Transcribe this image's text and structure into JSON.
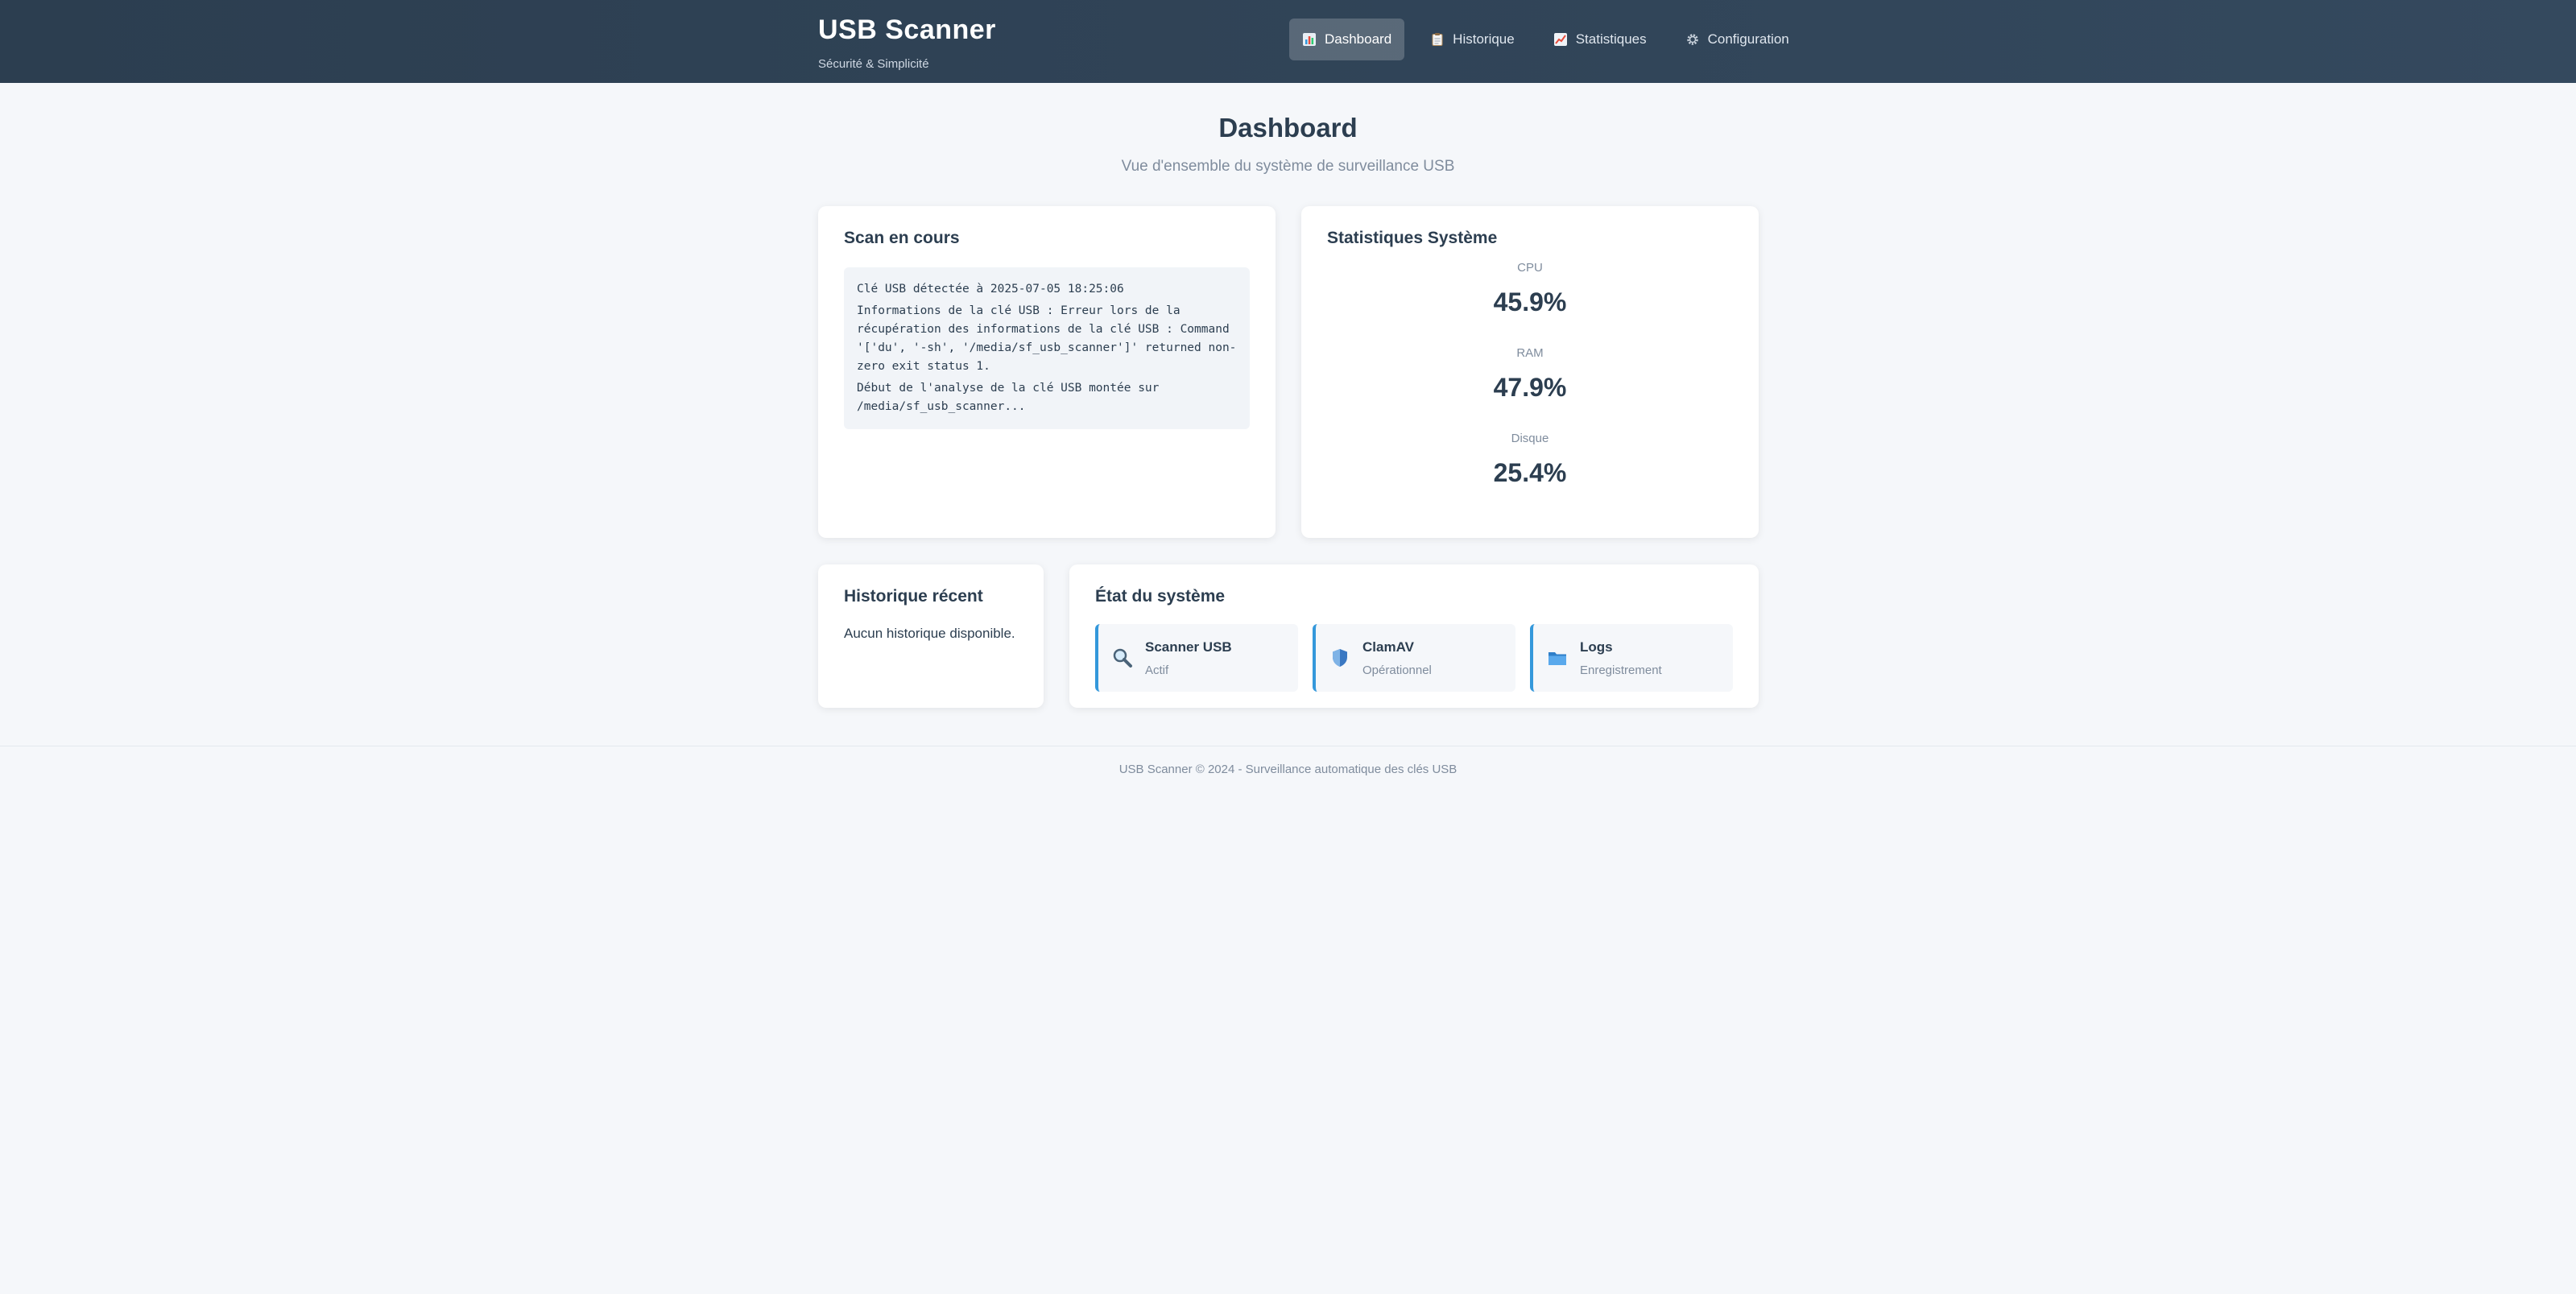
{
  "header": {
    "title": "USB Scanner",
    "subtitle": "Sécurité & Simplicité",
    "nav": [
      {
        "label": "Dashboard",
        "icon": "dashboard-chart-icon",
        "active": true
      },
      {
        "label": "Historique",
        "icon": "clipboard-icon",
        "active": false
      },
      {
        "label": "Statistiques",
        "icon": "trend-chart-icon",
        "active": false
      },
      {
        "label": "Configuration",
        "icon": "gear-icon",
        "active": false
      }
    ]
  },
  "main": {
    "title": "Dashboard",
    "subtitle": "Vue d'ensemble du système de surveillance USB"
  },
  "scan": {
    "title": "Scan en cours",
    "log": [
      "Clé USB détectée à 2025-07-05 18:25:06",
      "Informations de la clé USB : Erreur lors de la récupération des informations de la clé USB : Command '['du', '-sh', '/media/sf_usb_scanner']' returned non-zero exit status 1.",
      "Début de l'analyse de la clé USB montée sur /media/sf_usb_scanner..."
    ]
  },
  "stats": {
    "title": "Statistiques Système",
    "items": [
      {
        "label": "CPU",
        "value": "45.9%"
      },
      {
        "label": "RAM",
        "value": "47.9%"
      },
      {
        "label": "Disque",
        "value": "25.4%"
      }
    ]
  },
  "history": {
    "title": "Historique récent",
    "empty_text": "Aucun historique disponible."
  },
  "system": {
    "title": "État du système",
    "accent": "#3498db",
    "items": [
      {
        "name": "Scanner USB",
        "status": "Actif",
        "icon": "magnifier-icon"
      },
      {
        "name": "ClamAV",
        "status": "Opérationnel",
        "icon": "shield-icon"
      },
      {
        "name": "Logs",
        "status": "Enregistrement",
        "icon": "folder-icon"
      }
    ]
  },
  "footer": {
    "text": "USB Scanner © 2024 - Surveillance automatique des clés USB"
  }
}
